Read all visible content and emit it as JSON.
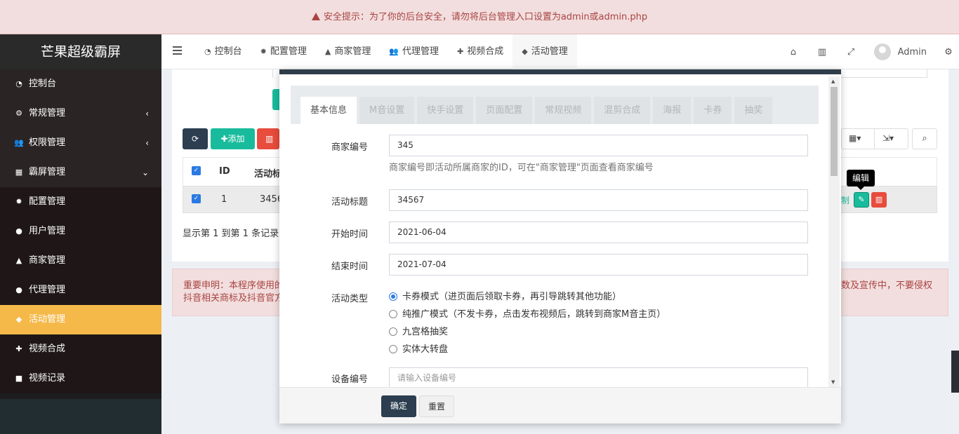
{
  "notice": {
    "text": "安全提示：为了你的后台安全，请勿将后台管理入口设置为admin或admin.php"
  },
  "brand": "芒果超级霸屏",
  "sidebar": {
    "items": [
      {
        "label": "控制台",
        "icon": "dashboard-icon"
      },
      {
        "label": "常规管理",
        "icon": "cogs-icon",
        "arrow": "‹"
      },
      {
        "label": "权限管理",
        "icon": "users-icon",
        "arrow": "‹"
      },
      {
        "label": "霸屏管理",
        "icon": "grid-icon",
        "arrow": "⌄"
      },
      {
        "label": "配置管理",
        "icon": "gear-icon"
      },
      {
        "label": "用户管理",
        "icon": "user-icon"
      },
      {
        "label": "商家管理",
        "icon": "merchant-icon"
      },
      {
        "label": "代理管理",
        "icon": "user-icon"
      },
      {
        "label": "活动管理",
        "icon": "tag-icon"
      },
      {
        "label": "视频合成",
        "icon": "puzzle-icon"
      },
      {
        "label": "视频记录",
        "icon": "video-icon"
      }
    ]
  },
  "topnav": {
    "items": [
      {
        "label": "控制台",
        "icon": "dashboard-icon"
      },
      {
        "label": "配置管理",
        "icon": "gear-icon"
      },
      {
        "label": "商家管理",
        "icon": "merchant-icon"
      },
      {
        "label": "代理管理",
        "icon": "users-icon"
      },
      {
        "label": "视频合成",
        "icon": "puzzle-icon"
      },
      {
        "label": "活动管理",
        "icon": "tag-icon"
      }
    ],
    "user": "Admin"
  },
  "panel": {
    "add_label": "添加",
    "delete_label": "删",
    "col_id": "ID",
    "col_title": "活动标",
    "row_id": "1",
    "row_title": "3456",
    "row_tail": "制",
    "paging": "显示第 1 到第 1 条记录，"
  },
  "alert": {
    "line1_left": "重要申明：本程序使用的",
    "line1_right": "数及宣传中，不要侵权",
    "line2_left": "抖音相关商标及抖音官方"
  },
  "tooltip": "编辑",
  "modal": {
    "tabs": [
      "基本信息",
      "M音设置",
      "快手设置",
      "页面配置",
      "常规视频",
      "混剪合成",
      "海报",
      "卡券",
      "抽奖"
    ],
    "fields": {
      "merchant_label": "商家编号",
      "merchant_value": "345",
      "merchant_help": "商家编号即活动所属商家的ID，可在\"商家管理\"页面查看商家编号",
      "title_label": "活动标题",
      "title_value": "34567",
      "start_label": "开始时间",
      "start_value": "2021-06-04",
      "end_label": "结束时间",
      "end_value": "2021-07-04",
      "type_label": "活动类型",
      "types": [
        "卡券模式（进页面后领取卡券，再引导跳转其他功能）",
        "纯推广模式（不发卡券，点击发布视频后，跳转到商家M音主页）",
        "九宫格抽奖",
        "实体大转盘"
      ],
      "device_label": "设备编号",
      "device_placeholder": "请输入设备编号"
    },
    "confirm": "确定",
    "reset": "重置"
  }
}
